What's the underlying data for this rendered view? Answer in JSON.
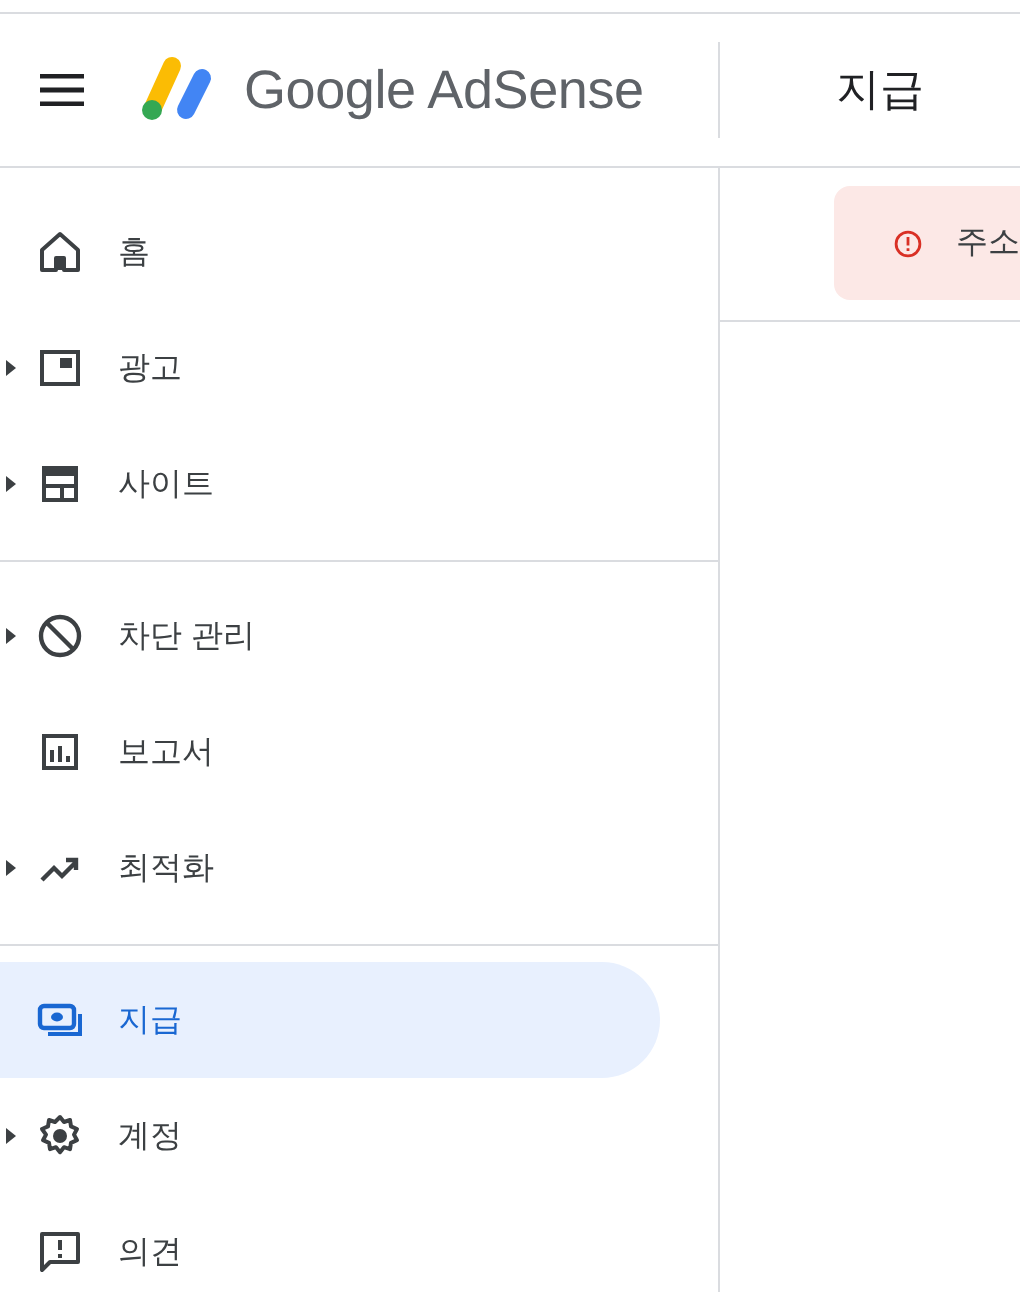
{
  "header": {
    "brand": "Google AdSense",
    "page_title": "지급"
  },
  "sidebar": {
    "groups": [
      {
        "items": [
          {
            "label": "홈",
            "expandable": false,
            "selected": false
          },
          {
            "label": "광고",
            "expandable": true,
            "selected": false
          },
          {
            "label": "사이트",
            "expandable": true,
            "selected": false
          }
        ]
      },
      {
        "items": [
          {
            "label": "차단 관리",
            "expandable": true,
            "selected": false
          },
          {
            "label": "보고서",
            "expandable": false,
            "selected": false
          },
          {
            "label": "최적화",
            "expandable": true,
            "selected": false
          }
        ]
      },
      {
        "items": [
          {
            "label": "지급",
            "expandable": false,
            "selected": true
          },
          {
            "label": "계정",
            "expandable": true,
            "selected": false
          },
          {
            "label": "의견",
            "expandable": false,
            "selected": false
          }
        ]
      }
    ]
  },
  "alert": {
    "text": "주소"
  }
}
